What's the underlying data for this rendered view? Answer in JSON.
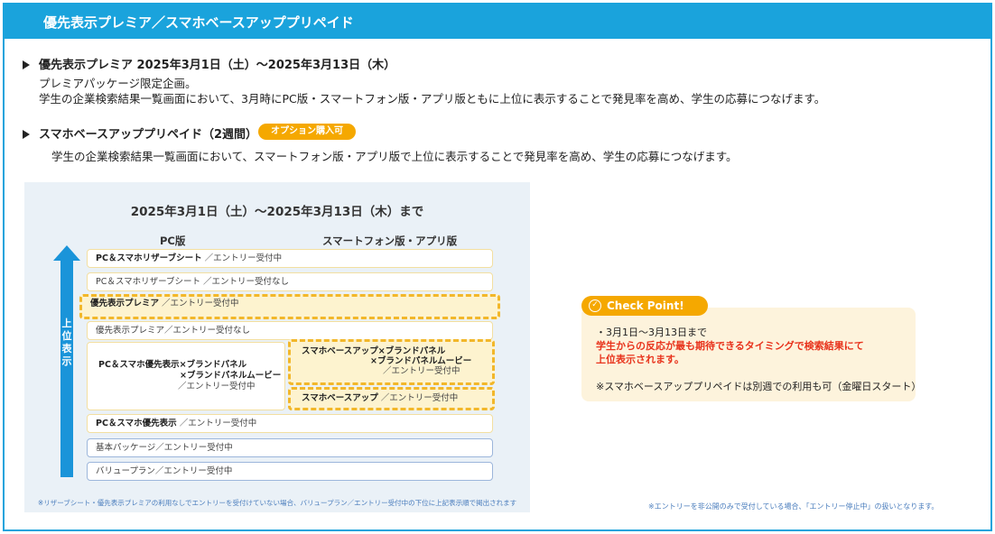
{
  "header": {
    "title": "優先表示プレミア／スマホベースアッププリペイド"
  },
  "section1": {
    "heading": "優先表示プレミア 2025年3月1日（土）～2025年3月13日（木）",
    "line1": "プレミアパッケージ限定企画。",
    "line2": "学生の企業検索結果一覧画面において、3月時にPC版・スマートフォン版・アプリ版ともに上位に表示することで発見率を高め、学生の応募につなげます。"
  },
  "section2": {
    "heading": "スマホベースアッププリペイド（2週間）",
    "badge": "オプション購入可",
    "line1": "学生の企業検索結果一覧画面において、スマートフォン版・アプリ版で上位に表示することで発見率を高め、学生の応募につなげます。"
  },
  "diagram": {
    "title": "2025年3月1日（土）～2025年3月13日（木）まで",
    "col_pc": "PC版",
    "col_sp": "スマートフォン版・アプリ版",
    "arrow_label": "上位表示",
    "rows": {
      "r1_bold": "PC＆スマホリザーブシート",
      "r1_rest": "／エントリー受付中",
      "r2": "PC＆スマホリザーブシート ／エントリー受付なし",
      "r3_bold": "優先表示プレミア",
      "r3_rest": "／エントリー受付中",
      "r4": "優先表示プレミア／エントリー受付なし",
      "r5_line1": "PC＆スマホ優先表示×ブランドパネル",
      "r5_line2": "×ブランドパネルムービー",
      "r5_line3": "／エントリー受付中",
      "r6_line1": "スマホベースアップ×ブランドパネル",
      "r6_line2": "×ブランドパネルムービー",
      "r6_line3": "／エントリー受付中",
      "r7_bold": "スマホベースアップ",
      "r7_rest": "／エントリー受付中",
      "r8_bold": "PC＆スマホ優先表示",
      "r8_rest": "／エントリー受付中",
      "r9": "基本パッケージ／エントリー受付中",
      "r10": "バリュープラン／エントリー受付中"
    },
    "note": "※リザーブシート・優先表示プレミアの利用なしでエントリーを受付けていない場合、バリュープラン／エントリー受付中の下位に上記表示順で掲出されます"
  },
  "check_point": {
    "tag": "Check Point!",
    "line1": "・3月1日～3月13日まで",
    "line2": "学生からの反応が最も期待できるタイミングで検索結果にて",
    "line3": "上位表示されます。",
    "line4": "※スマホベースアッププリペイドは別週での利用も可（金曜日スタート）"
  },
  "footnote": "※エントリーを非公開のみで受付している場合、「エントリー停止中」の扱いとなります。",
  "colors": {
    "accent": "#1aa3dc",
    "highlight": "#f5a800",
    "emphasis": "#e8331c"
  }
}
